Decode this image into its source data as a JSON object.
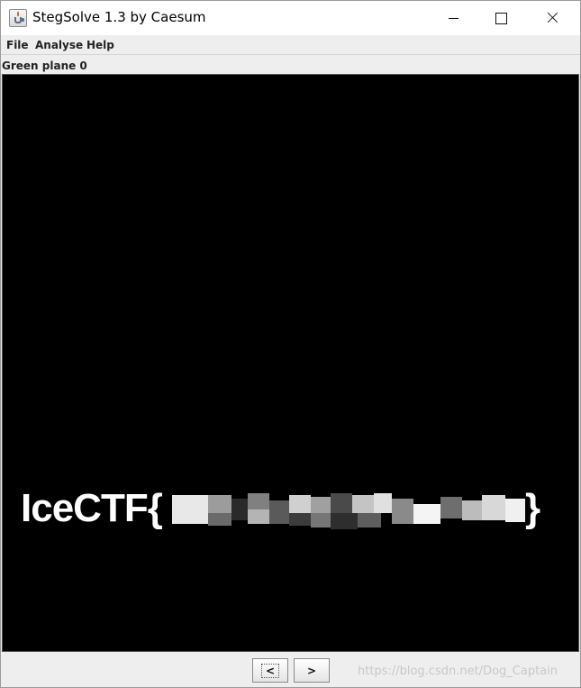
{
  "window": {
    "title": "StegSolve 1.3 by Caesum",
    "icon": "java-cup-icon"
  },
  "window_controls": {
    "minimize_icon": "minimize-icon",
    "maximize_icon": "maximize-icon",
    "close_icon": "close-icon"
  },
  "menu": {
    "items": [
      "File",
      "Analyse",
      "Help"
    ]
  },
  "viewer": {
    "plane_label": "Green plane 0",
    "revealed_text_prefix": "IceCTF{",
    "revealed_text_suffix": "}",
    "background_color": "#000000",
    "text_color": "#ffffff"
  },
  "navigation": {
    "prev_label": "<",
    "next_label": ">"
  },
  "watermark": "https://blog.csdn.net/Dog_Captain"
}
